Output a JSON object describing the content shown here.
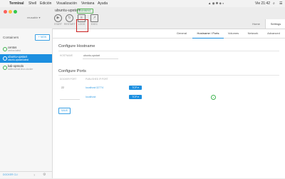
{
  "menubar": {
    "apple": "",
    "app": "Terminal",
    "items": [
      "Shell",
      "Edición",
      "Visualización",
      "Ventana",
      "Ayuda"
    ],
    "status_icons": "▲ ◉ ✱ ◈ ◐",
    "clock": "Vie 21:42",
    "search": "⌕",
    "list": "☰"
  },
  "titlebar": {
    "user": "reusable ▾",
    "container_name": "ubuntu-upstart",
    "status": "RUNNING",
    "tools": [
      {
        "label": "START",
        "icon": "▶"
      },
      {
        "label": "RESTART",
        "icon": "↻"
      },
      {
        "label": "LOGS",
        "icon": "≡"
      },
      {
        "label": "EXEC",
        "icon": "↗"
      }
    ],
    "home_tab": "Home",
    "settings_tab": "Settings"
  },
  "sidebar": {
    "heading": "Containers",
    "new_button": "+ NEW",
    "containers": [
      {
        "name": "centos",
        "sub": "centos:latest"
      },
      {
        "name": "ubuntu-upstart",
        "sub": "ubuntu-upstart:latest"
      },
      {
        "name": "kali-opssolo",
        "sub": "kalilinux/kali-linux-docker"
      }
    ],
    "footer_link": "DOCKER CLI",
    "help_icon": "?",
    "gear_icon": "⚙"
  },
  "tabs": [
    "General",
    "Hostname / Ports",
    "Volumes",
    "Network",
    "Advanced"
  ],
  "hostname_section": {
    "title": "Configure Hostname",
    "label": "HOSTNAME",
    "value": "ubuntu-upstart"
  },
  "ports_section": {
    "title": "Configure Ports",
    "col_docker": "DOCKER PORT",
    "col_published": "PUBLISHED IP:PORT",
    "rows": [
      {
        "docker_port": "22",
        "published": "localhost:32774",
        "protocol": "TCP ▾"
      },
      {
        "docker_port": "",
        "published": "localhost:",
        "protocol": "TCP ▾"
      }
    ],
    "add_icon": "+",
    "save_button": "SAVE"
  }
}
